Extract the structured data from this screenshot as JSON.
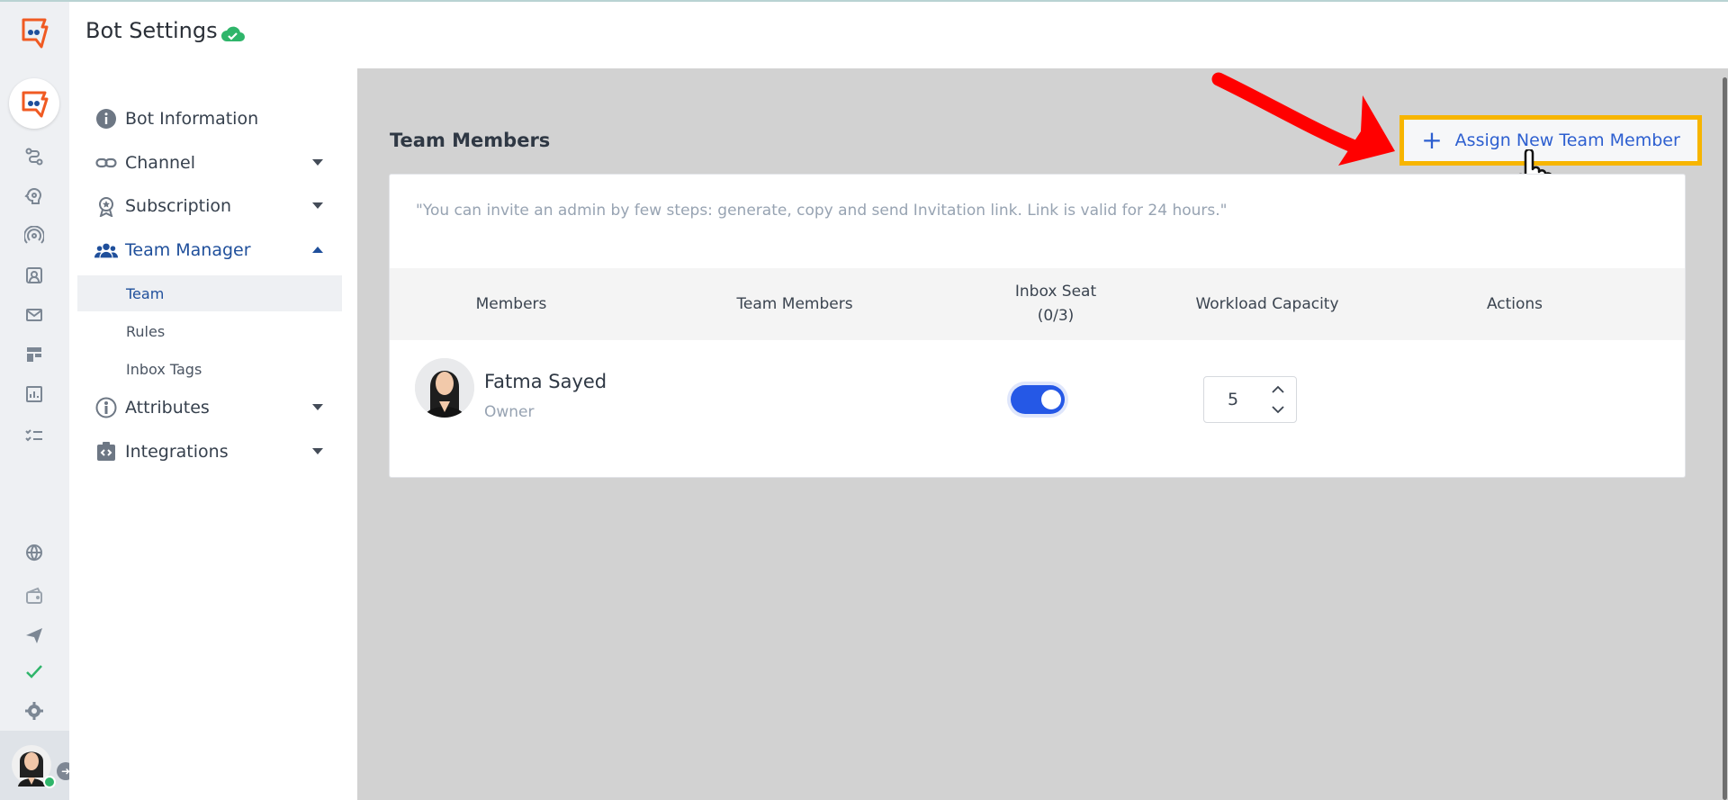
{
  "header": {
    "title": "Bot Settings"
  },
  "rail": {
    "icons": [
      "app-logo-icon",
      "bot-avatar-icon",
      "flow-icon",
      "brain-icon",
      "broadcast-icon",
      "contacts-icon",
      "mail-icon",
      "templates-icon",
      "analytics-icon",
      "tasks-icon",
      "globe-icon",
      "wallet-icon",
      "send-icon",
      "check-icon",
      "gear-icon"
    ]
  },
  "menu": {
    "items": [
      {
        "label": "Bot Information"
      },
      {
        "label": "Channel"
      },
      {
        "label": "Subscription"
      },
      {
        "label": "Team Manager"
      },
      {
        "label": "Attributes"
      },
      {
        "label": "Integrations"
      }
    ],
    "sub": [
      {
        "label": "Team"
      },
      {
        "label": "Rules"
      },
      {
        "label": "Inbox Tags"
      }
    ]
  },
  "main": {
    "section_title": "Team Members",
    "assign_button": {
      "icon": "+",
      "label": "Assign New Team Member"
    },
    "note": "\"You can invite an admin by few steps: generate, copy and send Invitation link. Link is valid for 24 hours.\"",
    "columns": {
      "members": "Members",
      "team_members": "Team Members",
      "inbox_seat_line1": "Inbox Seat",
      "inbox_seat_line2": "(0/3)",
      "workload": "Workload Capacity",
      "actions": "Actions"
    },
    "rows": [
      {
        "name": "Fatma Sayed",
        "role": "Owner",
        "inbox_seat_on": true,
        "workload": "5"
      }
    ]
  },
  "colors": {
    "accent": "#2558e6",
    "highlight": "#f7b500",
    "arrow": "#ff0000",
    "brand_orange": "#f05a22"
  }
}
